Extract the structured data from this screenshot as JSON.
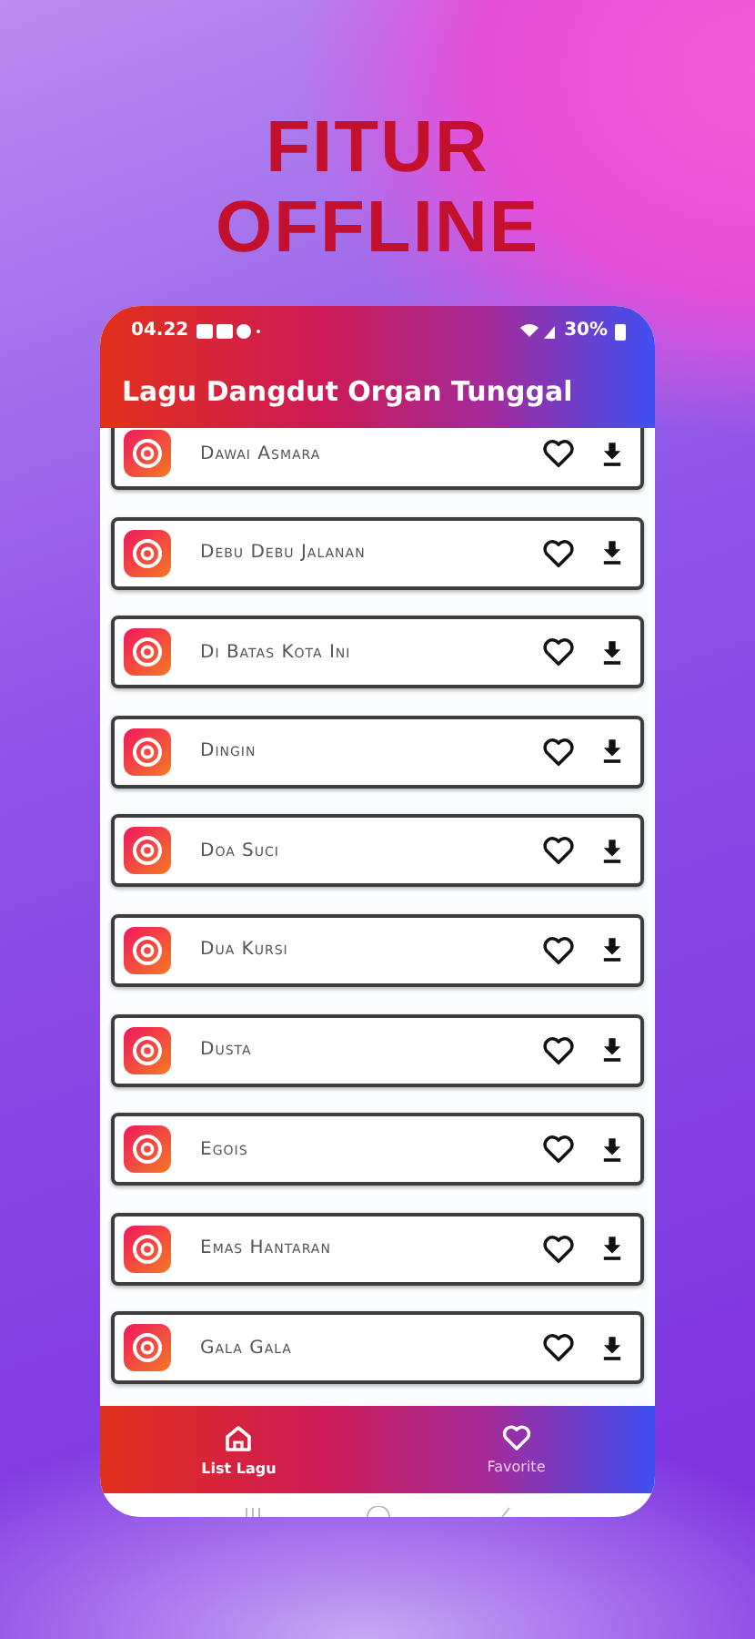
{
  "headline": [
    "FITUR",
    "OFFLINE"
  ],
  "status_bar": {
    "time": "04.22",
    "battery": "30%"
  },
  "app_bar": {
    "title": "Lagu Dangdut Organ Tunggal"
  },
  "songs": [
    {
      "title": "Dawai Asmara"
    },
    {
      "title": "Debu Debu Jalanan"
    },
    {
      "title": "Di Batas Kota Ini"
    },
    {
      "title": "Dingin"
    },
    {
      "title": "Doa Suci"
    },
    {
      "title": "Dua Kursi"
    },
    {
      "title": "Dusta"
    },
    {
      "title": "Egois"
    },
    {
      "title": "Emas Hantaran"
    },
    {
      "title": "Gala Gala"
    }
  ],
  "bottom_nav": [
    {
      "label": "List Lagu",
      "selected": true,
      "kind": "home"
    },
    {
      "label": "Favorite",
      "selected": false,
      "kind": "heart"
    }
  ]
}
